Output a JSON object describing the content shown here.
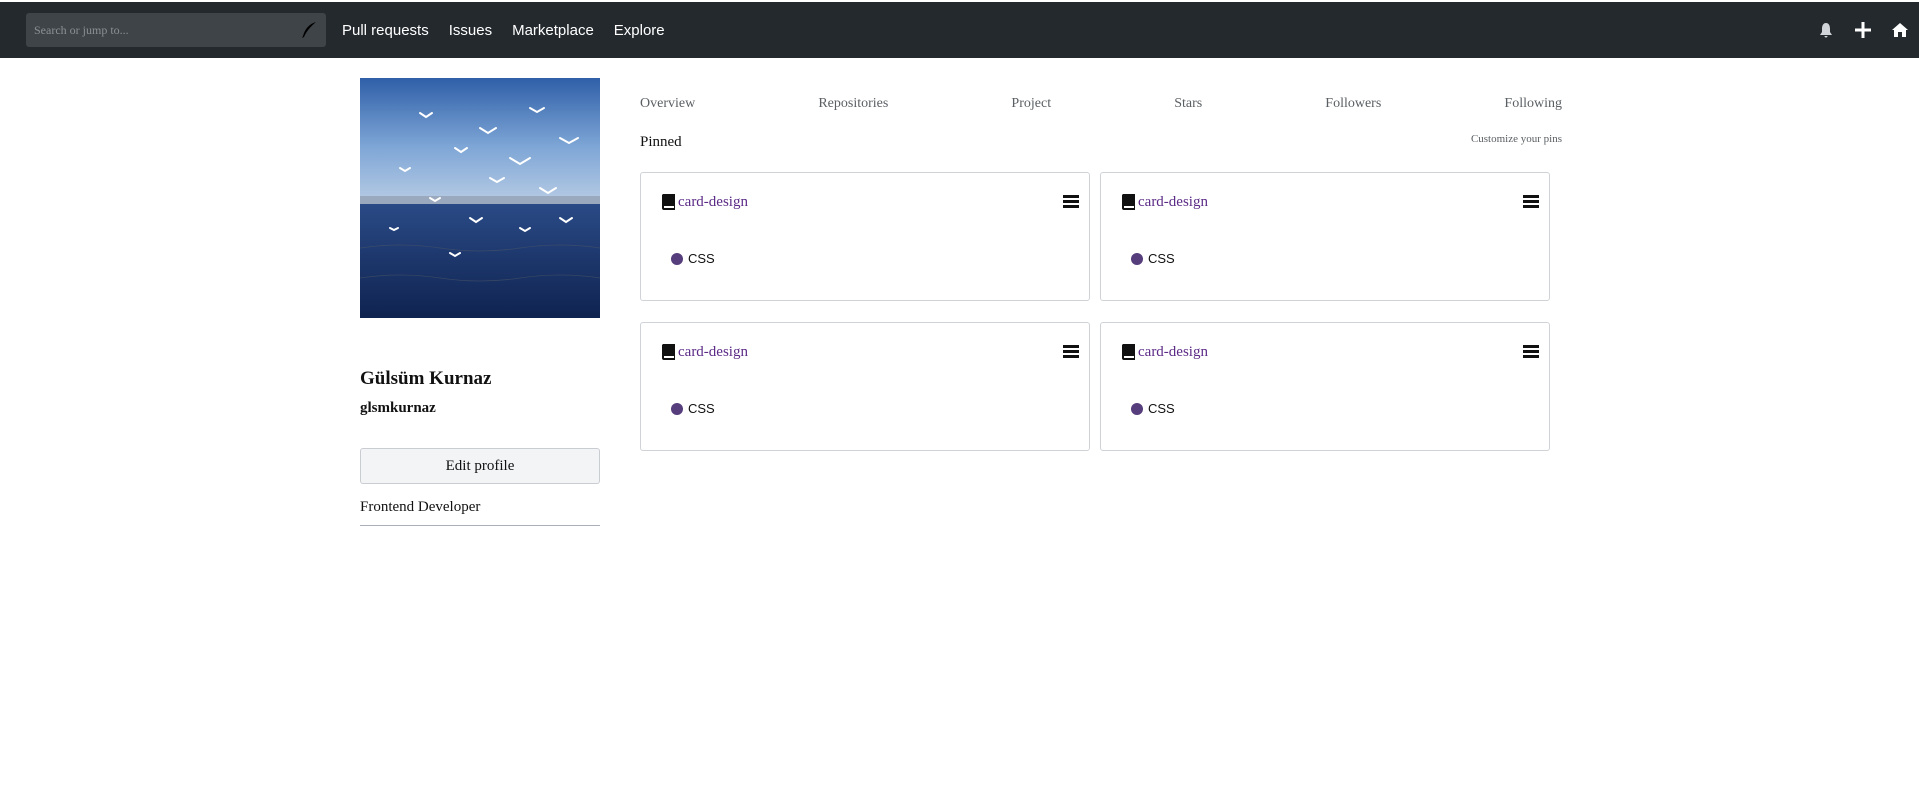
{
  "search": {
    "placeholder": "Search or jump to..."
  },
  "nav": {
    "links": [
      "Pull requests",
      "Issues",
      "Marketplace",
      "Explore"
    ]
  },
  "nav_right_icons": [
    "bell-icon",
    "plus-icon",
    "home-icon"
  ],
  "profile": {
    "name": "Gülsüm Kurnaz",
    "login": "glsmkurnaz",
    "edit_label": "Edit profile",
    "bio": "Frontend Developer"
  },
  "tabs": [
    "Overview",
    "Repositories",
    "Project",
    "Stars",
    "Followers",
    "Following"
  ],
  "pinned": {
    "title": "Pinned",
    "customize_label": "Customize your pins",
    "cards": [
      {
        "repo": "card-design",
        "language": "CSS"
      },
      {
        "repo": "card-design",
        "language": "CSS"
      },
      {
        "repo": "card-design",
        "language": "CSS"
      },
      {
        "repo": "card-design",
        "language": "CSS"
      }
    ]
  },
  "colors": {
    "topbar": "#24292e",
    "repo_link": "#5b2a86",
    "css_language": "#563d7c"
  }
}
